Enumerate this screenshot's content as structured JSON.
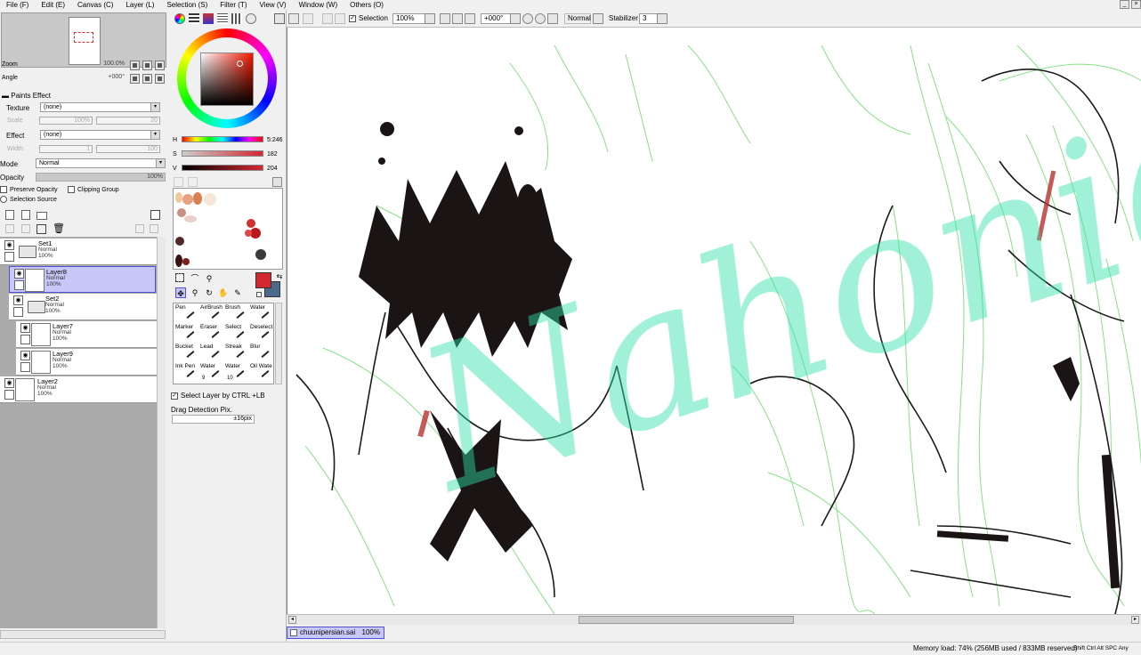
{
  "menu": [
    "File (F)",
    "Edit (E)",
    "Canvas (C)",
    "Layer (L)",
    "Selection (S)",
    "Filter (T)",
    "View (V)",
    "Window (W)",
    "Others (O)"
  ],
  "navigator": {
    "zoom_label": "Zoom",
    "zoom_value": "100.0%",
    "angle_label": "Angle",
    "angle_value": "+000°"
  },
  "paints_effect": {
    "title": "Paints Effect",
    "texture_label": "Texture",
    "texture_value": "(none)",
    "scale_label": "Scale",
    "scale_value": "100%",
    "scale_num": "20",
    "effect_label": "Effect",
    "effect_value": "(none)",
    "width_label": "Width",
    "width_value": "1",
    "width_num": "100"
  },
  "blend": {
    "mode_label": "Mode",
    "mode_value": "Normal",
    "opacity_label": "Opacity",
    "opacity_value": "100%",
    "preserve_opacity": "Preserve Opacity",
    "clipping_group": "Clipping Group",
    "selection_source": "Selection Source"
  },
  "layers": [
    {
      "name": "Set1",
      "mode": "Normal",
      "opacity": "100%"
    },
    {
      "name": "Layer8",
      "mode": "Normal",
      "opacity": "100%"
    },
    {
      "name": "Set2",
      "mode": "Normal",
      "opacity": "100%"
    },
    {
      "name": "Layer7",
      "mode": "Normal",
      "opacity": "100%"
    },
    {
      "name": "Layer9",
      "mode": "Normal",
      "opacity": "100%"
    },
    {
      "name": "Layer2",
      "mode": "Normal",
      "opacity": "100%"
    }
  ],
  "hsv": {
    "h_label": "H",
    "h_value": "5:246",
    "s_label": "S",
    "s_value": "182",
    "v_label": "V",
    "v_value": "204"
  },
  "colors": {
    "primary": "#d42830",
    "secondary": "#4a6a88",
    "layer_selected": "#c8c8f8",
    "accent_border": "#5050d0"
  },
  "brushes": [
    "Pen",
    "AirBrush",
    "Brush",
    "Water",
    "Marker",
    "Eraser",
    "Select",
    "Deselect",
    "Bucket",
    "Lead",
    "Streak",
    "Blur",
    "Ink Pen",
    "Water",
    "Water",
    "Oil Wate"
  ],
  "brush_sizes": [
    "9",
    "10"
  ],
  "tool_options": {
    "select_layer": "Select Layer by CTRL +LB",
    "drag_label": "Drag Detection Pix.",
    "drag_value": "±16pix"
  },
  "toolbar": {
    "selection_label": "Selection",
    "zoom_value": "100%",
    "angle_value": "+000°",
    "mode_value": "Normal",
    "stabilizer_label": "Stabilizer",
    "stabilizer_value": "3"
  },
  "document": {
    "filename": "chuunipersian.sai",
    "zoom": "100%"
  },
  "status": {
    "memory": "Memory load: 74% (256MB used / 833MB reserved)",
    "keys": "Shift Ctrl Alt SPC Any"
  },
  "watermark_text": "Nahoni@art"
}
